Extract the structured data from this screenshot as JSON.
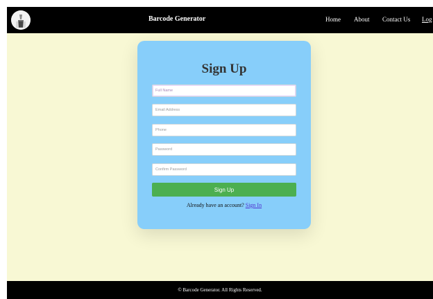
{
  "header": {
    "brand": "Barcode Generator",
    "logo_icon": "barcode-cup-logo",
    "nav": [
      "Home",
      "About",
      "Contact Us",
      "Log"
    ]
  },
  "form": {
    "title": "Sign Up",
    "fields": [
      {
        "placeholder": "Full Name",
        "value": ""
      },
      {
        "placeholder": "Email Address",
        "value": ""
      },
      {
        "placeholder": "Phone",
        "value": ""
      },
      {
        "placeholder": "Password",
        "value": ""
      },
      {
        "placeholder": "Confirm Password",
        "value": ""
      }
    ],
    "submit_label": "Sign Up",
    "signin_prompt": "Already have an account?",
    "signin_link": "Sign In"
  },
  "footer": {
    "text": "© Barcode Generator. All Rights Reserved."
  },
  "colors": {
    "page_bg": "#f8f8d4",
    "header_bg": "#000000",
    "card_bg": "#87cefa",
    "button_bg": "#4caf50",
    "link": "#4f2fd0"
  }
}
